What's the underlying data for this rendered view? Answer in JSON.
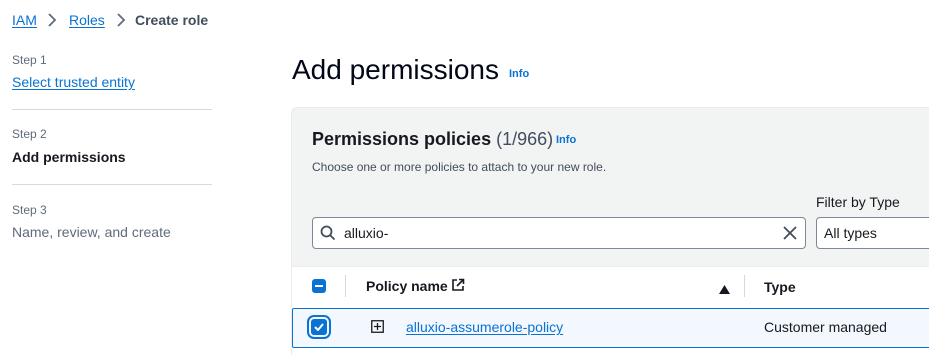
{
  "breadcrumb": {
    "items": [
      {
        "label": "IAM"
      },
      {
        "label": "Roles"
      },
      {
        "label": "Create role"
      }
    ]
  },
  "steps": [
    {
      "number": "Step 1",
      "name": "Select trusted entity",
      "state": "link"
    },
    {
      "number": "Step 2",
      "name": "Add permissions",
      "state": "current"
    },
    {
      "number": "Step 3",
      "name": "Name, review, and create",
      "state": "disabled"
    }
  ],
  "page": {
    "title": "Add permissions",
    "info": "Info"
  },
  "permissions": {
    "title": "Permissions policies",
    "count": "(1/966)",
    "info": "Info",
    "description": "Choose one or more policies to attach to your new role.",
    "search": {
      "value": "alluxio-"
    },
    "filter": {
      "label": "Filter by Type",
      "value": "All types"
    }
  },
  "table": {
    "columns": [
      {
        "label": "Policy name"
      },
      {
        "label": "Type"
      }
    ],
    "rows": [
      {
        "policy_name": "alluxio-assumerole-policy",
        "type": "Customer managed",
        "selected": true
      }
    ]
  },
  "colors": {
    "accent": "#0972d3",
    "text": "#16191f",
    "muted": "#5f6b7a",
    "panel_bg": "#f2f3f3",
    "selected_row_bg": "#f2f8fd"
  }
}
